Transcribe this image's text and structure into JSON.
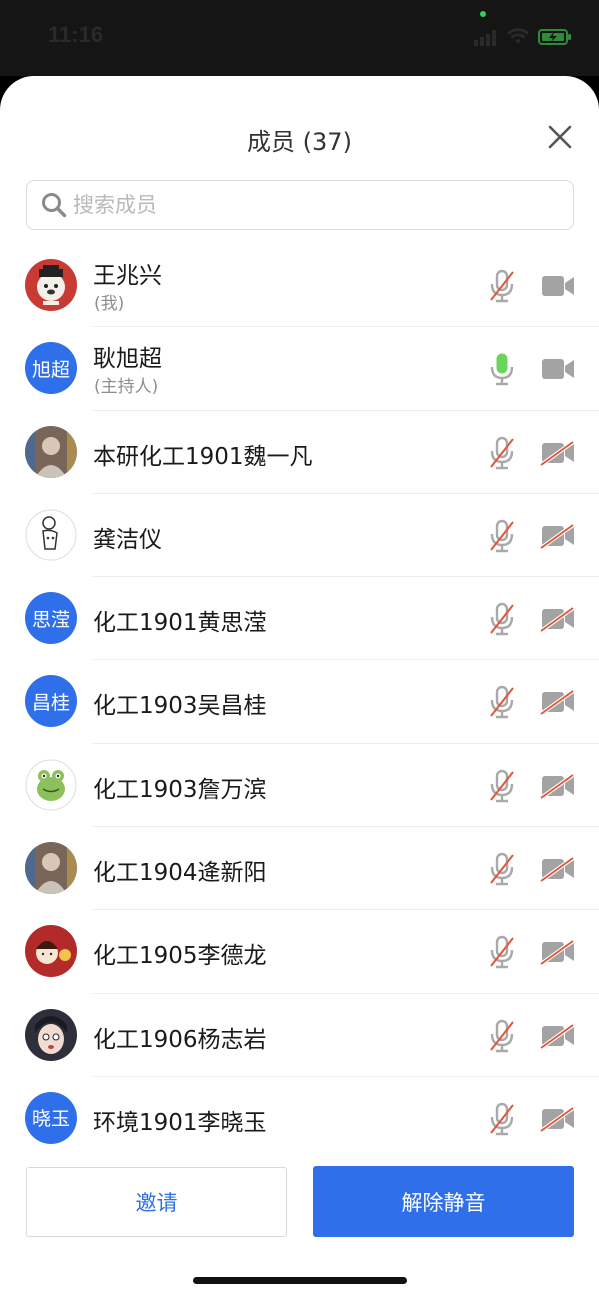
{
  "status_bar": {
    "time": "11:16"
  },
  "header": {
    "title": "成员 (37)"
  },
  "search": {
    "placeholder": "搜索成员",
    "value": ""
  },
  "members": [
    {
      "name": "王兆兴",
      "role": "(我)",
      "avatar_text": "",
      "avatar": "bulldog-avatar-icon",
      "mic": "muted",
      "camera": "on"
    },
    {
      "name": "耿旭超",
      "role": "(主持人)",
      "avatar_text": "旭超",
      "avatar": "initials",
      "mic": "active",
      "camera": "on"
    },
    {
      "name": "本研化工1901魏一凡",
      "role": "",
      "avatar_text": "",
      "avatar": "photo-avatar-icon",
      "mic": "muted",
      "camera": "off"
    },
    {
      "name": "龚洁仪",
      "role": "",
      "avatar_text": "",
      "avatar": "sketch-avatar-icon",
      "mic": "muted",
      "camera": "off"
    },
    {
      "name": "化工1901黄思滢",
      "role": "",
      "avatar_text": "思滢",
      "avatar": "initials",
      "mic": "muted",
      "camera": "off"
    },
    {
      "name": "化工1903吴昌桂",
      "role": "",
      "avatar_text": "昌桂",
      "avatar": "initials",
      "mic": "muted",
      "camera": "off"
    },
    {
      "name": "化工1903詹万滨",
      "role": "",
      "avatar_text": "",
      "avatar": "frog-avatar-icon",
      "mic": "muted",
      "camera": "off"
    },
    {
      "name": "化工1904逄新阳",
      "role": "",
      "avatar_text": "",
      "avatar": "photo-avatar-icon",
      "mic": "muted",
      "camera": "off"
    },
    {
      "name": "化工1905李德龙",
      "role": "",
      "avatar_text": "",
      "avatar": "red-card-avatar-icon",
      "mic": "muted",
      "camera": "off"
    },
    {
      "name": "化工1906杨志岩",
      "role": "",
      "avatar_text": "",
      "avatar": "cartoon-face-avatar-icon",
      "mic": "muted",
      "camera": "off"
    },
    {
      "name": "环境1901李晓玉",
      "role": "",
      "avatar_text": "晓玉",
      "avatar": "initials",
      "mic": "muted",
      "camera": "off"
    }
  ],
  "footer": {
    "invite_label": "邀请",
    "unmute_label": "解除静音"
  },
  "colors": {
    "accent": "#2f6fe9",
    "mic_active": "#6bd45c",
    "muted_slash": "#e0563b",
    "icon_gray": "#9a9a9a"
  }
}
